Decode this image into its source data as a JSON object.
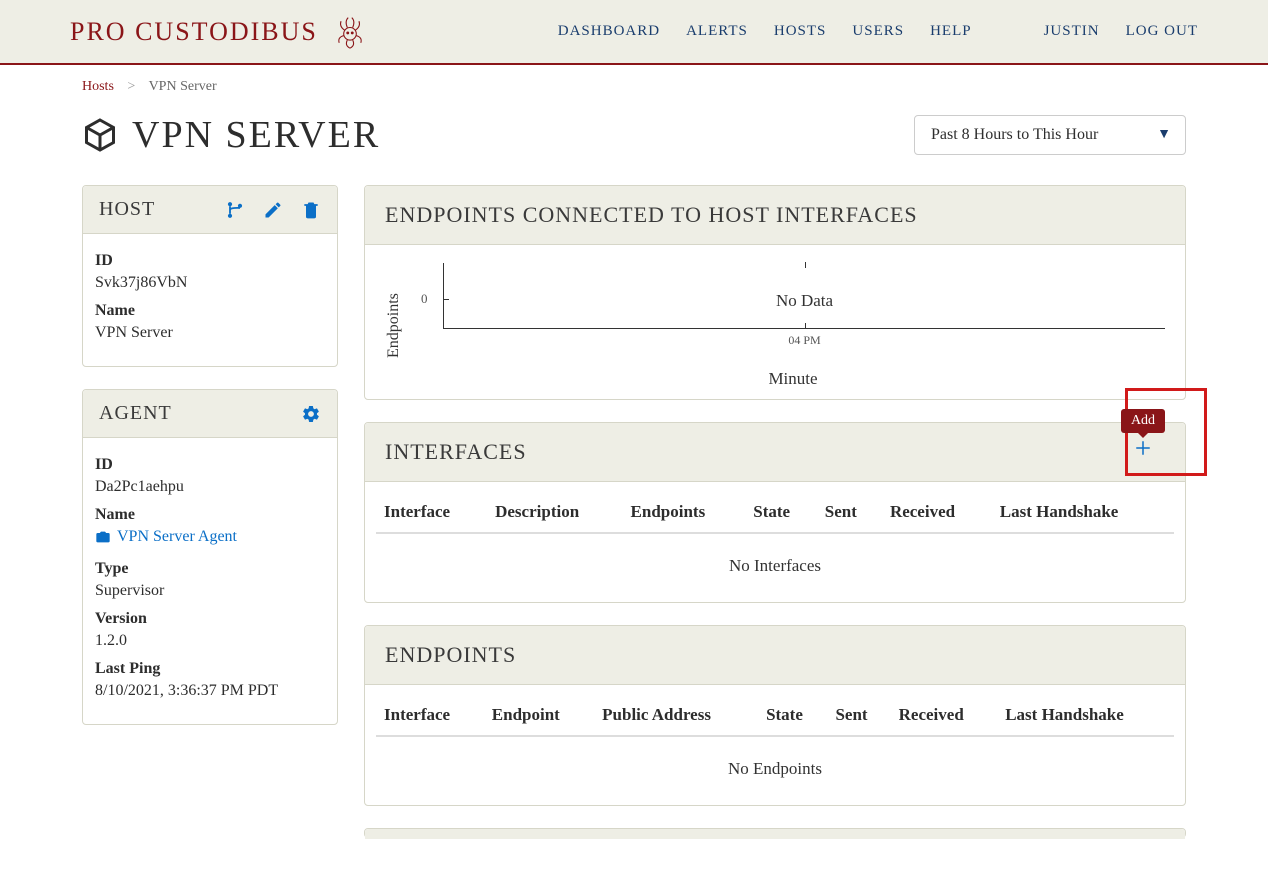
{
  "brand": "PRO CUSTODIBUS",
  "nav": {
    "dashboard": "DASHBOARD",
    "alerts": "ALERTS",
    "hosts": "HOSTS",
    "users": "USERS",
    "help": "HELP",
    "user": "JUSTIN",
    "logout": "LOG OUT"
  },
  "breadcrumb": {
    "parent": "Hosts",
    "sep": ">",
    "current": "VPN Server"
  },
  "page_title": "VPN SERVER",
  "time_range": "Past 8 Hours to This Hour",
  "host_panel": {
    "title": "HOST",
    "id_label": "ID",
    "id_value": "Svk37j86VbN",
    "name_label": "Name",
    "name_value": "VPN Server"
  },
  "agent_panel": {
    "title": "AGENT",
    "id_label": "ID",
    "id_value": "Da2Pc1aehpu",
    "name_label": "Name",
    "name_value": "VPN Server Agent",
    "type_label": "Type",
    "type_value": "Supervisor",
    "version_label": "Version",
    "version_value": "1.2.0",
    "ping_label": "Last Ping",
    "ping_value": "8/10/2021, 3:36:37 PM PDT"
  },
  "chart_panel": {
    "title": "ENDPOINTS CONNECTED TO HOST INTERFACES",
    "ylabel": "Endpoints",
    "ytick": "0",
    "no_data": "No Data",
    "xtick": "04 PM",
    "xlabel": "Minute"
  },
  "chart_data": {
    "type": "line",
    "title": "Endpoints Connected to Host Interfaces",
    "xlabel": "Minute",
    "ylabel": "Endpoints",
    "categories": [
      "04 PM"
    ],
    "values": [],
    "ylim": [
      0,
      0
    ],
    "note": "No Data"
  },
  "interfaces_panel": {
    "title": "INTERFACES",
    "add_tooltip": "Add",
    "columns": {
      "interface": "Interface",
      "description": "Description",
      "endpoints": "Endpoints",
      "state": "State",
      "sent": "Sent",
      "received": "Received",
      "handshake": "Last Handshake"
    },
    "empty": "No Interfaces"
  },
  "endpoints_panel": {
    "title": "ENDPOINTS",
    "columns": {
      "interface": "Interface",
      "endpoint": "Endpoint",
      "address": "Public Address",
      "state": "State",
      "sent": "Sent",
      "received": "Received",
      "handshake": "Last Handshake"
    },
    "empty": "No Endpoints"
  }
}
